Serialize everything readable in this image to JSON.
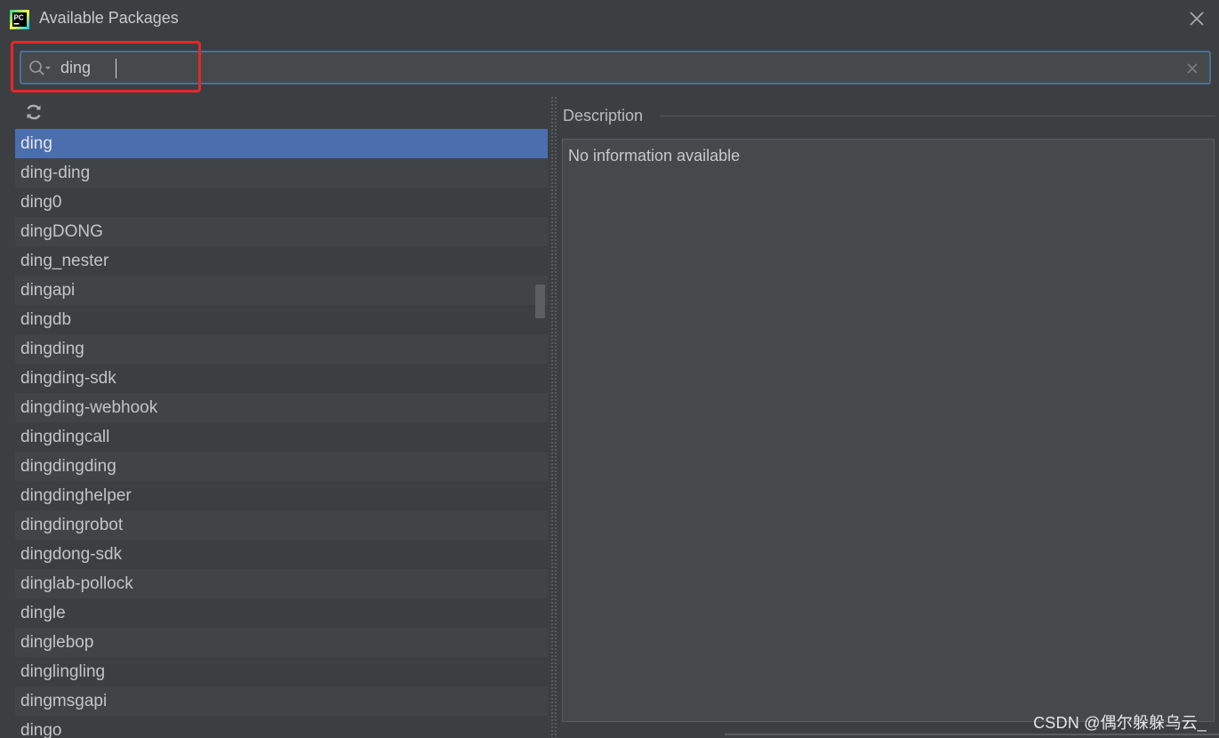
{
  "window": {
    "title": "Available Packages",
    "logo_text": "PC",
    "icons": {
      "logo": "pycharm-logo",
      "close": "close-icon"
    }
  },
  "search": {
    "value": "ding",
    "placeholder": "",
    "icons": {
      "search": "search-icon",
      "clear": "clear-icon"
    }
  },
  "toolbar": {
    "refresh_icon": "refresh-icon"
  },
  "packages": {
    "selected_index": 0,
    "items": [
      "ding",
      "ding-ding",
      "ding0",
      "dingDONG",
      "ding_nester",
      "dingapi",
      "dingdb",
      "dingding",
      "dingding-sdk",
      "dingding-webhook",
      "dingdingcall",
      "dingdingding",
      "dingdinghelper",
      "dingdingrobot",
      "dingdong-sdk",
      "dinglab-pollock",
      "dingle",
      "dinglebop",
      "dinglingling",
      "dingmsgapi",
      "dingo"
    ]
  },
  "description": {
    "label": "Description",
    "text": "No information available"
  },
  "watermark": "CSDN @偶尔躲躲乌云_",
  "colors": {
    "background": "#3c3f41",
    "selection": "#4b6eaf",
    "focus_border": "#4a6f96",
    "annotation_red": "#e8262a"
  }
}
